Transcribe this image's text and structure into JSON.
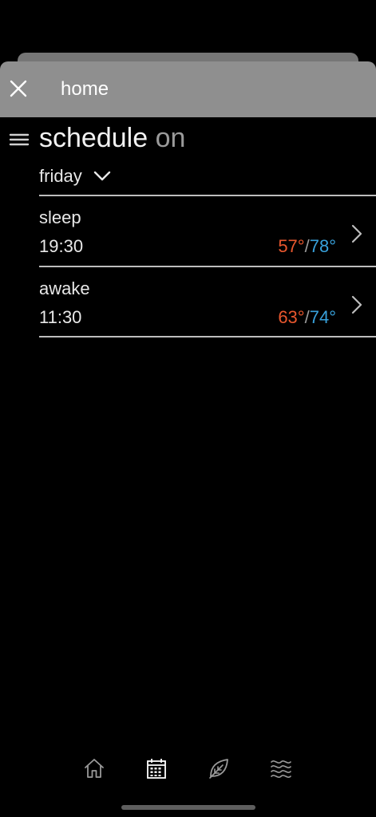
{
  "header": {
    "title": "home",
    "close_icon": "close-icon"
  },
  "page": {
    "menu_icon": "menu-icon",
    "title": "schedule",
    "status": "on"
  },
  "day_selector": {
    "value": "friday",
    "icon": "chevron-down-icon"
  },
  "schedule": [
    {
      "name": "sleep",
      "time": "19:30",
      "heat": "57°",
      "cool": "78°"
    },
    {
      "name": "awake",
      "time": "11:30",
      "heat": "63°",
      "cool": "74°"
    }
  ],
  "temp_separator": "/",
  "colors": {
    "heat": "#e8572e",
    "cool": "#38a1db",
    "header_bg": "#8f8f8f",
    "background": "#000000"
  },
  "bottom_nav": [
    {
      "icon": "home-icon",
      "selected": false
    },
    {
      "icon": "calendar-icon",
      "selected": true
    },
    {
      "icon": "leaf-icon",
      "selected": false
    },
    {
      "icon": "waves-icon",
      "selected": false
    }
  ]
}
